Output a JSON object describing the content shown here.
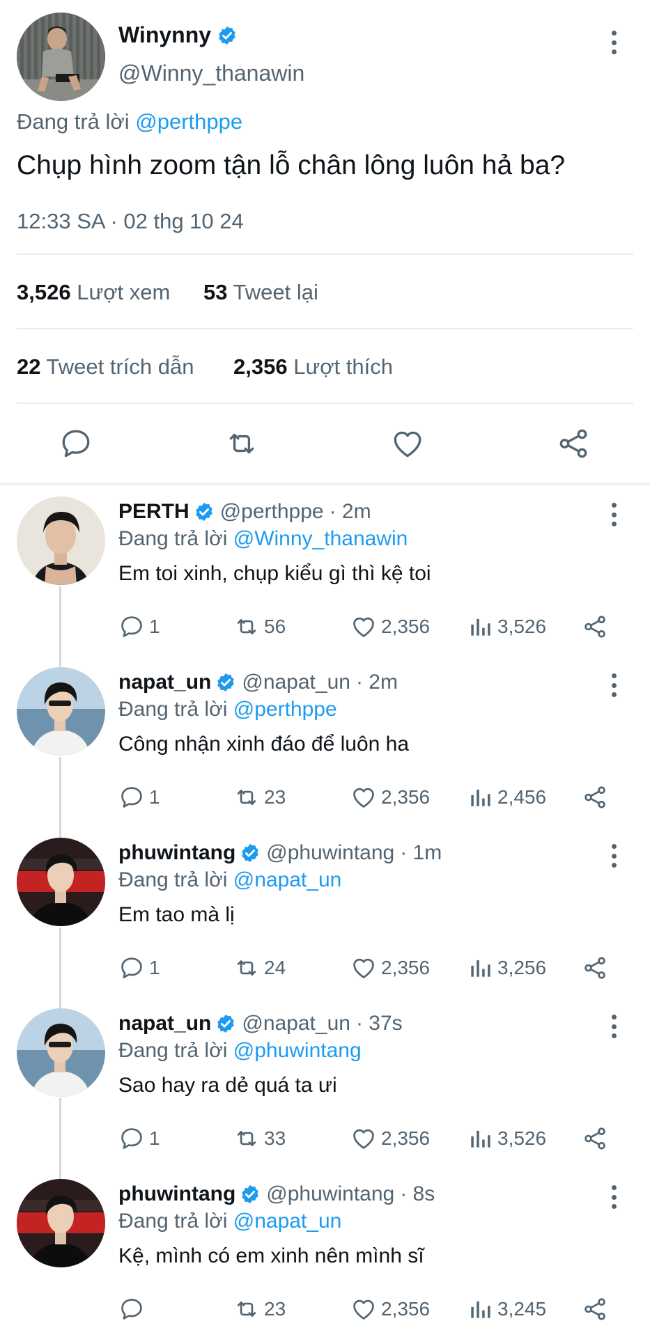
{
  "main_tweet": {
    "author_name": "Winynny",
    "author_handle": "@Winny_thanawin",
    "replying_prefix": "Đang trả lời",
    "replying_to": "@perthppe",
    "text": "Chụp hình zoom tận lỗ chân lông luôn hả ba?",
    "timestamp": "12:33 SA · 02 thg 10 24",
    "stats": {
      "views_count": "3,526",
      "views_label": "Lượt xem",
      "retweets_count": "53",
      "retweets_label": "Tweet lại",
      "quotes_count": "22",
      "quotes_label": "Tweet trích dẫn",
      "likes_count": "2,356",
      "likes_label": "Lượt thích"
    },
    "actions": [
      "reply-icon",
      "retweet-icon",
      "like-icon",
      "share-icon"
    ]
  },
  "replies": [
    {
      "name": "PERTH",
      "handle": "@perthppe",
      "time": "· 2m",
      "replying_prefix": "Đang trả lời",
      "replying_to": "@Winny_thanawin",
      "text": "Em toi xinh, chụp kiểu gì thì kệ toi",
      "reply_count": "1",
      "retweet_count": "56",
      "like_count": "2,356",
      "view_count": "3,526"
    },
    {
      "name": "napat_un",
      "handle": "@napat_un",
      "time": "· 2m",
      "replying_prefix": "Đang trả lời",
      "replying_to": "@perthppe",
      "text": "Công nhận xinh đáo để luôn ha",
      "reply_count": "1",
      "retweet_count": "23",
      "like_count": "2,356",
      "view_count": "2,456"
    },
    {
      "name": "phuwintang",
      "handle": "@phuwintang",
      "time": "· 1m",
      "replying_prefix": "Đang trả lời",
      "replying_to": "@napat_un",
      "text": "Em tao mà lị",
      "reply_count": "1",
      "retweet_count": "24",
      "like_count": "2,356",
      "view_count": "3,256"
    },
    {
      "name": "napat_un",
      "handle": "@napat_un",
      "time": "· 37s",
      "replying_prefix": "Đang trả lời",
      "replying_to": "@phuwintang",
      "text": "Sao hay ra dẻ quá ta ưi",
      "reply_count": "1",
      "retweet_count": "33",
      "like_count": "2,356",
      "view_count": "3,526"
    },
    {
      "name": "phuwintang",
      "handle": "@phuwintang",
      "time": "· 8s",
      "replying_prefix": "Đang trả lời",
      "replying_to": "@napat_un",
      "text": "Kệ, mình có em xinh nên mình sĩ",
      "reply_count": "",
      "retweet_count": "23",
      "like_count": "2,356",
      "view_count": "3,245"
    }
  ],
  "colors": {
    "accent": "#1d9bf0",
    "text_primary": "#0f1419",
    "text_secondary": "#536471",
    "divider": "#e6ecf0"
  }
}
